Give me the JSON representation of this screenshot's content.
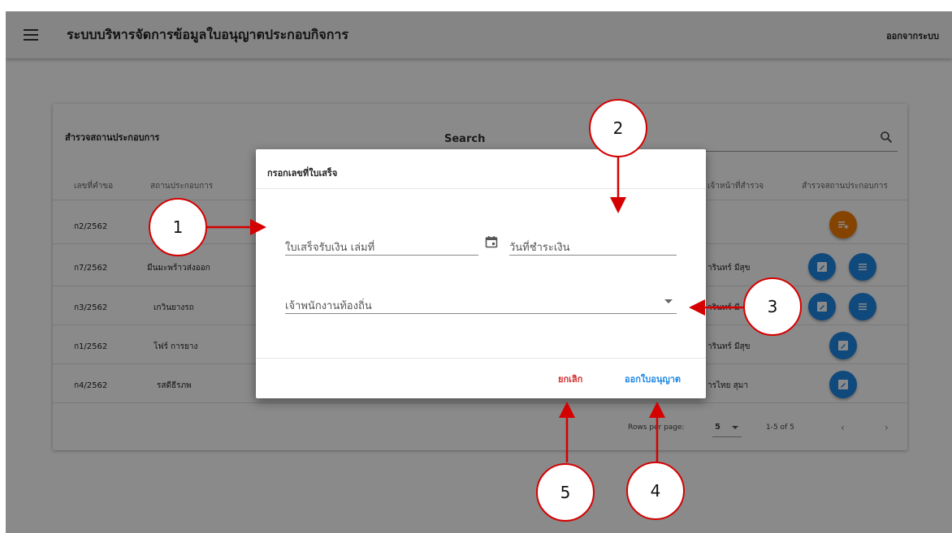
{
  "app": {
    "title": "ระบบบริหารจัดการข้อมูลใบอนุญาตประกอบกิจการ",
    "logout_label": "ออกจากระบบ",
    "menu_icon": "hamburger-menu-icon"
  },
  "table_card": {
    "title": "สำรวจสถานประกอบการ",
    "search_label": "Search",
    "search_icon": "search-icon",
    "columns": [
      "เลขที่คำขอ",
      "สถานประกอบการ",
      "เจ้าหน้าที่สำรวจ",
      "สำรวจสถานประกอบการ"
    ],
    "rows": [
      {
        "request_no": "ก2/2562",
        "business": "",
        "officer": "",
        "actions": [
          "add-list-icon"
        ]
      },
      {
        "request_no": "ก7/2562",
        "business": "มีนมะพร้าวส่งออก",
        "officer": "ารินทร์ มีสุข",
        "actions": [
          "edit-icon",
          "list-icon"
        ]
      },
      {
        "request_no": "ก3/2562",
        "business": "เกวินยางรถ",
        "officer": "ารินทร์ มี",
        "actions": [
          "edit-icon",
          "list-icon"
        ]
      },
      {
        "request_no": "ก1/2562",
        "business": "โฟร์ การยาง",
        "officer": "ารินทร์ มีสุข",
        "actions": [
          "edit-icon"
        ]
      },
      {
        "request_no": "ก4/2562",
        "business": "รสดีธีรภพ",
        "officer": "ารไทย สุมา",
        "actions": [
          "edit-icon"
        ]
      }
    ],
    "footer": {
      "rows_per_page_label": "Rows per page:",
      "rows_per_page_value": "5",
      "range": "1-5 of 5"
    }
  },
  "dialog": {
    "title": "กรอกเลขที่ใบเสร็จ",
    "receipt_book_placeholder": "ใบเสร็จรับเงิน เล่มที่",
    "payment_date_placeholder": "วันที่ชำระเงิน",
    "officer_select_placeholder": "เจ้าพนักงานท้องถิ่น",
    "cancel_label": "ยกเลิก",
    "issue_label": "ออกใบอนุญาต"
  },
  "annotations": [
    "1",
    "2",
    "3",
    "4",
    "5"
  ],
  "colors": {
    "primary_blue": "#1e88e5",
    "orange": "#f57c00",
    "cancel_red": "#d32f2f",
    "annotation_red": "#d50000"
  }
}
